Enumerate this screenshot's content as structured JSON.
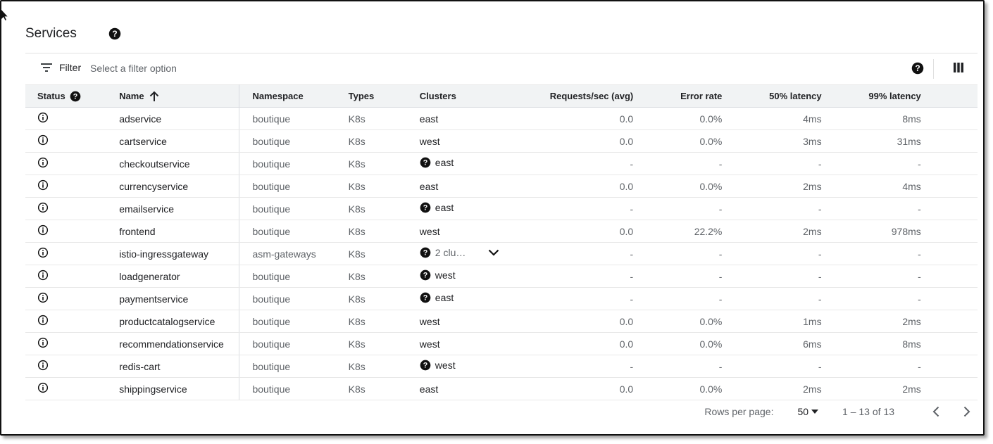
{
  "page": {
    "title": "Services"
  },
  "filter": {
    "label": "Filter",
    "placeholder": "Select a filter option"
  },
  "columns": {
    "status": "Status",
    "name": "Name",
    "namespace": "Namespace",
    "types": "Types",
    "clusters": "Clusters",
    "requests": "Requests/sec (avg)",
    "error_rate": "Error rate",
    "p50": "50% latency",
    "p99": "99% latency"
  },
  "rows": [
    {
      "name": "adservice",
      "namespace": "boutique",
      "type": "K8s",
      "cluster": "east",
      "cluster_help": false,
      "requests": "0.0",
      "error_rate": "0.0%",
      "p50": "4ms",
      "p99": "8ms"
    },
    {
      "name": "cartservice",
      "namespace": "boutique",
      "type": "K8s",
      "cluster": "west",
      "cluster_help": false,
      "requests": "0.0",
      "error_rate": "0.0%",
      "p50": "3ms",
      "p99": "31ms"
    },
    {
      "name": "checkoutservice",
      "namespace": "boutique",
      "type": "K8s",
      "cluster": "east",
      "cluster_help": true,
      "requests": "-",
      "error_rate": "-",
      "p50": "-",
      "p99": "-"
    },
    {
      "name": "currencyservice",
      "namespace": "boutique",
      "type": "K8s",
      "cluster": "east",
      "cluster_help": false,
      "requests": "0.0",
      "error_rate": "0.0%",
      "p50": "2ms",
      "p99": "4ms"
    },
    {
      "name": "emailservice",
      "namespace": "boutique",
      "type": "K8s",
      "cluster": "east",
      "cluster_help": true,
      "requests": "-",
      "error_rate": "-",
      "p50": "-",
      "p99": "-"
    },
    {
      "name": "frontend",
      "namespace": "boutique",
      "type": "K8s",
      "cluster": "west",
      "cluster_help": false,
      "requests": "0.0",
      "error_rate": "22.2%",
      "p50": "2ms",
      "p99": "978ms"
    },
    {
      "name": "istio-ingressgateway",
      "namespace": "asm-gateways",
      "type": "K8s",
      "cluster": "2 clu…",
      "cluster_help": true,
      "cluster_expand": true,
      "requests": "-",
      "error_rate": "-",
      "p50": "-",
      "p99": "-"
    },
    {
      "name": "loadgenerator",
      "namespace": "boutique",
      "type": "K8s",
      "cluster": "west",
      "cluster_help": true,
      "requests": "-",
      "error_rate": "-",
      "p50": "-",
      "p99": "-"
    },
    {
      "name": "paymentservice",
      "namespace": "boutique",
      "type": "K8s",
      "cluster": "east",
      "cluster_help": true,
      "requests": "-",
      "error_rate": "-",
      "p50": "-",
      "p99": "-"
    },
    {
      "name": "productcatalogservice",
      "namespace": "boutique",
      "type": "K8s",
      "cluster": "west",
      "cluster_help": false,
      "requests": "0.0",
      "error_rate": "0.0%",
      "p50": "1ms",
      "p99": "2ms"
    },
    {
      "name": "recommendationservice",
      "namespace": "boutique",
      "type": "K8s",
      "cluster": "west",
      "cluster_help": false,
      "requests": "0.0",
      "error_rate": "0.0%",
      "p50": "6ms",
      "p99": "8ms"
    },
    {
      "name": "redis-cart",
      "namespace": "boutique",
      "type": "K8s",
      "cluster": "west",
      "cluster_help": true,
      "requests": "-",
      "error_rate": "-",
      "p50": "-",
      "p99": "-"
    },
    {
      "name": "shippingservice",
      "namespace": "boutique",
      "type": "K8s",
      "cluster": "east",
      "cluster_help": false,
      "requests": "0.0",
      "error_rate": "0.0%",
      "p50": "2ms",
      "p99": "2ms"
    }
  ],
  "pagination": {
    "rows_per_page_label": "Rows per page:",
    "rows_per_page": "50",
    "range": "1 – 13 of 13"
  },
  "icons": {
    "help": "help-circle-icon",
    "info": "info-outline-icon",
    "filter": "filter-list-icon",
    "columns": "view-column-icon",
    "sort": "arrow-up-icon",
    "expand": "chevron-down-icon"
  }
}
